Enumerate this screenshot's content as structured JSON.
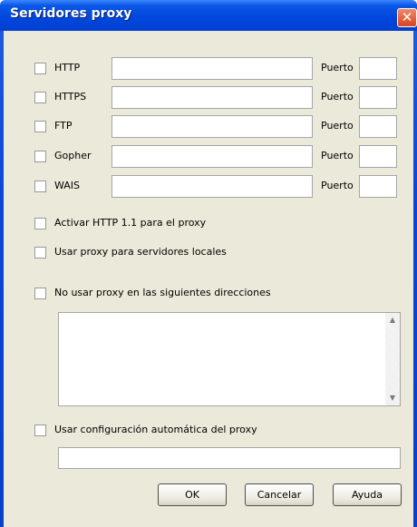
{
  "window": {
    "title": "Servidores proxy",
    "close_symbol": "✕"
  },
  "protocols": [
    {
      "label": "HTTP",
      "port_label": "Puerto"
    },
    {
      "label": "HTTPS",
      "port_label": "Puerto"
    },
    {
      "label": "FTP",
      "port_label": "Puerto"
    },
    {
      "label": "Gopher",
      "port_label": "Puerto"
    },
    {
      "label": "WAIS",
      "port_label": "Puerto"
    }
  ],
  "options": {
    "http11": "Activar HTTP 1.1 para el proxy",
    "local": "Usar proxy para servidores locales",
    "noproxy": "No usar proxy en las siguientes direcciones",
    "autoconfig": "Usar configuración automática del proxy"
  },
  "buttons": {
    "ok": "OK",
    "cancel": "Cancelar",
    "help": "Ayuda"
  },
  "colors": {
    "titlebar": "#0a57e6",
    "dialog_bg": "#ebe9d9",
    "close": "#d8431f"
  }
}
